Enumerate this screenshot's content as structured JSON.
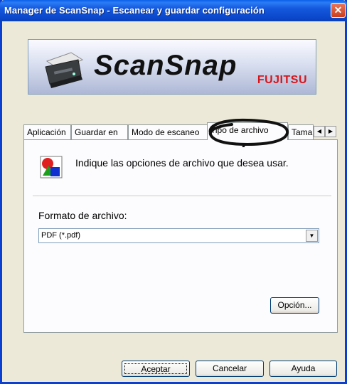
{
  "window": {
    "title": "Manager de ScanSnap - Escanear y guardar configuración",
    "close_glyph": "✕"
  },
  "banner": {
    "brand": "ScanSnap",
    "company": "FUJITSU",
    "icons": {
      "scanner": "scanner-illustration"
    }
  },
  "tabs": [
    {
      "label": "Aplicación",
      "active": false
    },
    {
      "label": "Guardar en",
      "active": false
    },
    {
      "label": "Modo de escaneo",
      "active": false
    },
    {
      "label": "Tipo de archivo",
      "active": true
    },
    {
      "label": "Tamaño",
      "active": false
    }
  ],
  "tab_scroll": {
    "left_glyph": "◀",
    "right_glyph": "▶"
  },
  "panel": {
    "info_text": "Indique las opciones de archivo que desea usar.",
    "format_label": "Formato de archivo:",
    "format_value": "PDF (*.pdf)",
    "dropdown_glyph": "▼",
    "option_button": "Opción..."
  },
  "buttons": {
    "accept": "Aceptar",
    "cancel": "Cancelar",
    "help": "Ayuda"
  },
  "colors": {
    "titlebar": "#0a47c9",
    "close": "#c93d1c",
    "brand_red": "#d7141a",
    "annotation": "#111111"
  }
}
